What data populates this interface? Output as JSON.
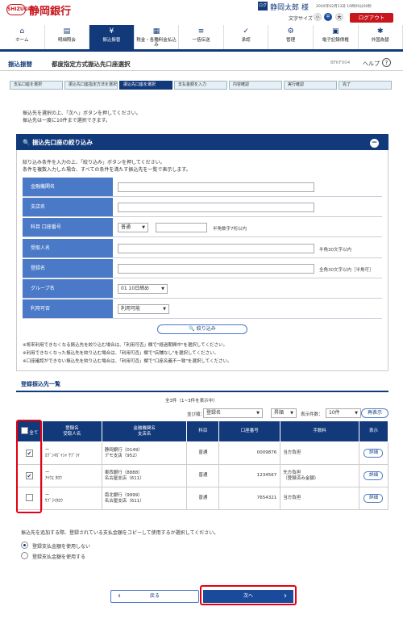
{
  "header": {
    "logo_text": "SHIZUGIN",
    "bank_name": "静岡銀行",
    "user_icon": "ログ",
    "user_name": "静岡太郎 様",
    "last_login": "20XX年02月13日 10時00分00秒",
    "fontsize_label": "文字サイズ",
    "fs_small": "小",
    "fs_medium": "中",
    "fs_large": "大",
    "logout": "ログアウト"
  },
  "nav": [
    {
      "icon": "⌂",
      "label": "ホーム"
    },
    {
      "icon": "▤",
      "label": "明細照会"
    },
    {
      "icon": "¥",
      "label": "振込振替"
    },
    {
      "icon": "▦",
      "label": "税金・各種料金払込み"
    },
    {
      "icon": "≡",
      "label": "一括伝送"
    },
    {
      "icon": "✓",
      "label": "承認"
    },
    {
      "icon": "⚙",
      "label": "管理"
    },
    {
      "icon": "▣",
      "label": "電子記録債権"
    },
    {
      "icon": "✱",
      "label": "外国為替"
    }
  ],
  "page": {
    "category": "振込振替",
    "title": "都度指定方式振込先口座選択",
    "code": "BFKF004",
    "help": "ヘルプ",
    "help_icon": "?"
  },
  "steps": [
    "支払口座を選択",
    "振込先口座指定方法を選択",
    "振込先口座を選択",
    "支払金額を入力",
    "内容確認",
    "実行確認",
    "完了"
  ],
  "intro": [
    "振込先を選択の上、「次へ」ボタンを押してください。",
    "振込先は一度に10件まで選択できます。"
  ],
  "filter": {
    "title": "振込先口座の絞り込み",
    "toggle": "−",
    "desc1": "絞り込み条件を入力の上、「絞り込み」ボタンを押してください。",
    "desc2": "条件を複数入力した場合、すべての条件を満たす振込先を一覧で表示します。",
    "labels": {
      "bank": "金融機関名",
      "branch": "支店名",
      "account": "科目 口座番号",
      "payee": "受取人名",
      "reg_name": "登録名",
      "group": "グループ名",
      "availability": "利用可否"
    },
    "account_type": "普通",
    "account_hint": "半角数字7桁以内",
    "payee_hint": "半角30文字以内",
    "reg_hint": "全角30文字以内［半角可］",
    "group_value": "01 10日締め",
    "availability_value": "利用可能",
    "button": "絞り込み",
    "notes": [
      "※将来利用できなくなる振込先を絞り込む場合は、「利用可否」欄で\"経過期間中\"を選択してください。",
      "※利用できなくなった振込先を絞り込む場合は、「利用可否」欄で\"店舗なし\"を選択してください。",
      "※口座確認ができない振込先を絞り込む場合は、「利用可否」欄で\"口座名義不一致\"を選択してください。"
    ]
  },
  "list": {
    "title": "登録振込先一覧",
    "count": "全3件（1~3件を表示中）",
    "sort_label": "並び順：",
    "sort_key": "登録名",
    "sort_order": "昇順",
    "per_page_label": "表示件数：",
    "per_page": "10件",
    "redisplay": "再表示",
    "headers": {
      "select_all": "全て",
      "name": "登録名\n受取人名",
      "bank": "金融機関名\n支店名",
      "type": "科目",
      "account": "口座番号",
      "fee": "手数料",
      "view": "表示"
    },
    "rows": [
      {
        "checked": true,
        "check": "✔",
        "reg": "ー",
        "payee": "ｶﾌﾞｼｷｶﾞｲｼｬ ｻﾌﾟﾗｲ",
        "bank": "静岡銀行（0149）",
        "branch": "デモ支店（952）",
        "type": "普通",
        "account": "0009876",
        "fee": "当方負担",
        "detail": "詳細"
      },
      {
        "checked": true,
        "check": "✔",
        "reg": "ー",
        "payee": "ｱｲｳｴ ﾀﾛｳ",
        "bank": "東西銀行（8888）",
        "branch": "名古屋支店（611）",
        "type": "普通",
        "account": "1234567",
        "fee": "先方負担\n（登録済み金額）",
        "detail": "詳細"
      },
      {
        "checked": false,
        "check": "",
        "reg": "ー",
        "payee": "ｻﾌﾟﾗｲﾀﾛｳ",
        "bank": "南北銀行（9999）",
        "branch": "名古屋支店（611）",
        "type": "普通",
        "account": "7654321",
        "fee": "当方負担",
        "detail": "詳細"
      }
    ]
  },
  "copy": {
    "question": "振込先を追加する際、登録されている支払金額をコピーして使用するか選択してください。",
    "opt1": "登録支払金額を使用しない",
    "opt2": "登録支払金額を使用する"
  },
  "buttons": {
    "back": "戻る",
    "back_icon": "‹",
    "next": "次へ",
    "next_icon": "›"
  }
}
